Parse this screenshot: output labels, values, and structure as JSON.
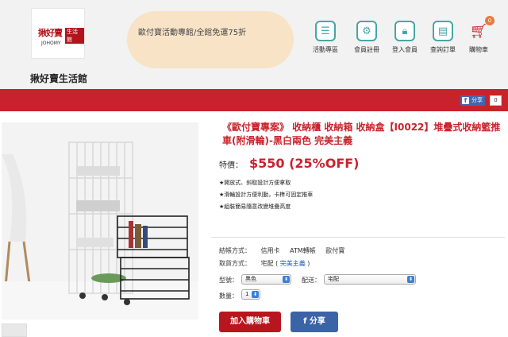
{
  "header": {
    "logo": {
      "zh": "揪好賣",
      "en": "JOHOMY",
      "tag": "生活館"
    },
    "shop_name": "揪好賣生活館",
    "promo_text": "歐付寶活動專館/全館免運75折",
    "nav": [
      {
        "label": "活動專區",
        "icon": "list-icon"
      },
      {
        "label": "會員註冊",
        "icon": "gear-icon"
      },
      {
        "label": "登入會員",
        "icon": "lock-icon"
      },
      {
        "label": "查詢訂單",
        "icon": "document-icon"
      },
      {
        "label": "購物車",
        "icon": "cart-icon"
      }
    ],
    "cart_count": "0"
  },
  "share": {
    "label": "分享",
    "count": "0"
  },
  "product": {
    "title": "《歐付寶專案》 收納櫃 收納箱 收納盒【I0022】堆疊式收納籃推車(附滑輪)-黑白兩色 完美主義",
    "price_label": "特價：",
    "price": "$550 (25%OFF)",
    "features": [
      "★開放式、斜取設計方便拿取",
      "★滑輪設計方便利動，卡榫可固定推車",
      "★組裝簡易隨意改變堆疊高度"
    ],
    "payment_label": "結帳方式：",
    "payment_methods": [
      "信用卡",
      "ATM轉帳",
      "歐付寶"
    ],
    "vendor_label": "取貨方式：",
    "vendor_name": "宅配",
    "vendor_link": "完美主義",
    "model_label": "型號：",
    "model_value": "黑色",
    "shipping_label": "配送：",
    "shipping_value": "宅配",
    "qty_label": "數量：",
    "qty_value": "1",
    "add_to_cart": "加入購物車",
    "share_button": "f 分享"
  },
  "colors": {
    "brand_red": "#c8232c",
    "teal": "#46a6a6",
    "fb_blue": "#3b63a8"
  }
}
